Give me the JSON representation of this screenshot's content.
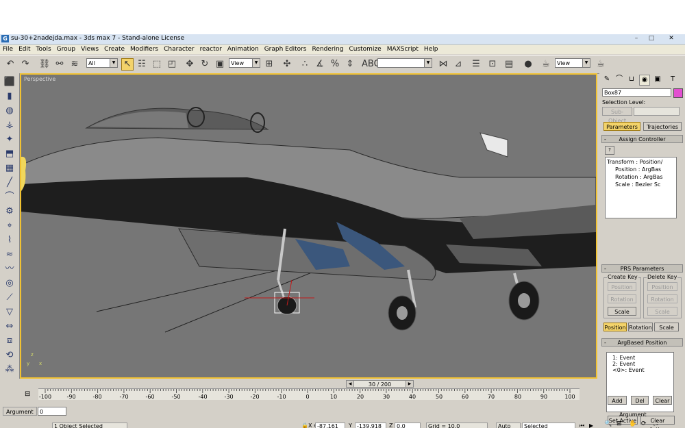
{
  "window": {
    "title": "su-30+2nadejda.max - 3ds max 7 - Stand-alone License",
    "controls": [
      "–",
      "□",
      "✕"
    ]
  },
  "menu": [
    "File",
    "Edit",
    "Tools",
    "Group",
    "Views",
    "Create",
    "Modifiers",
    "Character",
    "reactor",
    "Animation",
    "Graph Editors",
    "Rendering",
    "Customize",
    "MAXScript",
    "Help"
  ],
  "toolbar": {
    "selection_filter": "All",
    "ref_coord_1": "View",
    "ref_coord_2": "View"
  },
  "viewport": {
    "label": "Perspective",
    "axis_labels": [
      "x",
      "y",
      "z"
    ]
  },
  "command_panel": {
    "object_name": "Box87",
    "object_color": "#e24fd0",
    "selection_level_label": "Selection Level:",
    "sub_object_label": "Sub-Object",
    "tabs": {
      "parameters": "Parameters",
      "trajectories": "Trajectories"
    },
    "assign_controller": {
      "title": "Assign Controller",
      "tree": [
        "Transform : Position/",
        "Position : ArgBas",
        "Rotation : ArgBas",
        "Scale : Bezier Sc"
      ]
    },
    "prs": {
      "title": "PRS Parameters",
      "create_key": "Create Key",
      "delete_key": "Delete Key",
      "position": "Position",
      "rotation": "Rotation",
      "scale": "Scale"
    },
    "argbased": {
      "title": "ArgBased Position",
      "events": [
        "1: Event",
        "2: Event",
        "<0>: Event"
      ],
      "set_active": "Set Active",
      "clear_active": "Clear Active",
      "add": "Add",
      "del": "Del",
      "clear": "Clear",
      "argument_label": "Argument"
    }
  },
  "timeline": {
    "frame_display": "30 / 200",
    "ticks": [
      "-100",
      "-90",
      "-80",
      "-70",
      "-60",
      "-50",
      "-40",
      "-30",
      "-20",
      "-10",
      "0",
      "10",
      "20",
      "30",
      "40",
      "50",
      "60",
      "70",
      "80",
      "90",
      "100"
    ]
  },
  "status_bar": {
    "argument_label": "Argument",
    "argument_value": "0",
    "selection_status": "1 Object Selected",
    "x_label": "X",
    "x_value": "-87.161",
    "y_label": "Y",
    "y_value": "-139.918",
    "z_label": "Z",
    "z_value": "0.0",
    "grid": "Grid = 10.0",
    "auto_key": "Auto Key",
    "key_filter": "Selected"
  }
}
